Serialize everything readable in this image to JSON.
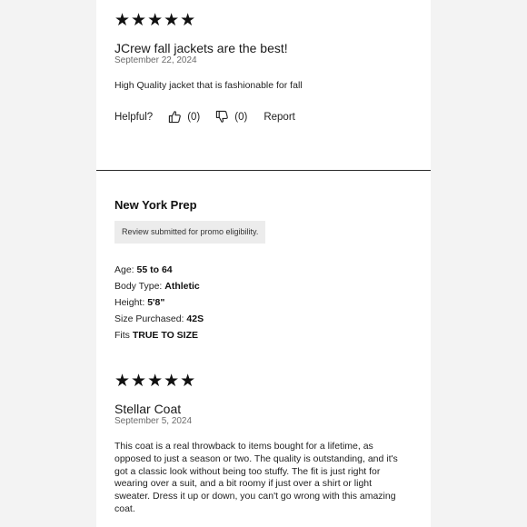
{
  "reviews": [
    {
      "stars": "★★★★★",
      "title": "JCrew fall jackets are the best!",
      "date": "September 22, 2024",
      "body": "High Quality jacket that is fashionable for fall",
      "helpful_label": "Helpful?",
      "upvotes": "(0)",
      "downvotes": "(0)",
      "report_label": "Report"
    }
  ],
  "second_review": {
    "reviewer_name": "New York Prep",
    "promo_badge": "Review submitted for promo eligibility.",
    "attributes": [
      {
        "label": "Age: ",
        "value": "55 to 64"
      },
      {
        "label": "Body Type: ",
        "value": "Athletic"
      },
      {
        "label": "Height: ",
        "value": "5'8\""
      },
      {
        "label": "Size Purchased: ",
        "value": "42S"
      },
      {
        "label": "Fits ",
        "value": "TRUE TO SIZE"
      }
    ],
    "stars": "★★★★★",
    "title": "Stellar Coat",
    "date": "September 5, 2024",
    "body": "This coat is a real throwback to items bought for a lifetime, as opposed to just a season or two. The quality is outstanding, and it's got a classic look without being too stuffy. The fit is just right for wearing over a suit, and a bit roomy if just over a shirt or light sweater. Dress it up or down, you can't go wrong with this amazing coat."
  },
  "icons": {
    "thumbs_up": "thumbs-up-icon",
    "thumbs_down": "thumbs-down-icon",
    "star": "star-icon"
  }
}
